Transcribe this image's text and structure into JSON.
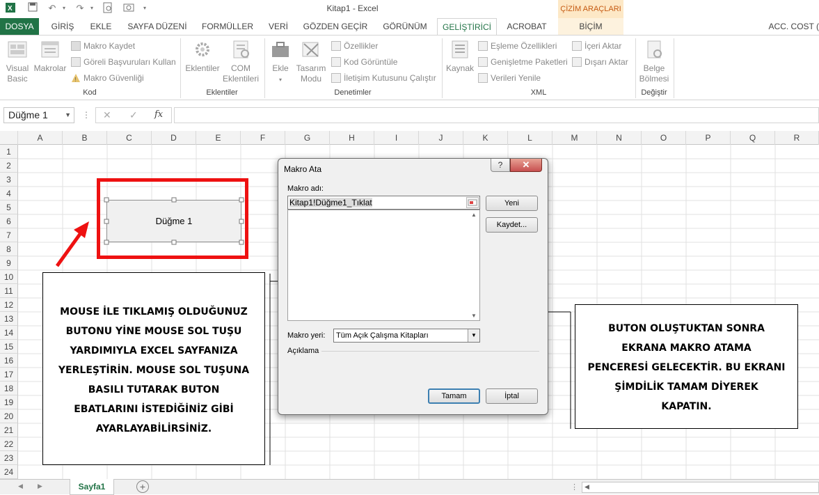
{
  "window": {
    "title": "Kitap1 - Excel"
  },
  "ribbon": {
    "contextual_header": "ÇİZİM ARAÇLARI",
    "tabs": [
      {
        "label": "DOSYA",
        "x": 0
      },
      {
        "label": "GİRİŞ"
      },
      {
        "label": "EKLE"
      },
      {
        "label": "SAYFA DÜZENİ"
      },
      {
        "label": "FORMÜLLER"
      },
      {
        "label": "VERİ"
      },
      {
        "label": "GÖZDEN GEÇİR"
      },
      {
        "label": "GÖRÜNÜM"
      },
      {
        "label": "GELİŞTİRİCİ"
      },
      {
        "label": "ACROBAT"
      },
      {
        "label": "BİÇİM"
      }
    ],
    "account": "ACC. COST (",
    "groups": {
      "kod": {
        "label": "Kod",
        "visual_basic": "Visual Basic",
        "visual_basic_l1": "Visual",
        "visual_basic_l2": "Basic",
        "makrolar": "Makrolar",
        "makro_kaydet": "Makro Kaydet",
        "goreli": "Göreli Başvuruları Kullan",
        "guvenlik": "Makro Güvenliği"
      },
      "eklentiler": {
        "label": "Eklentiler",
        "eklentiler": "Eklentiler",
        "com_l1": "COM",
        "com_l2": "Eklentileri"
      },
      "denetimler": {
        "label": "Denetimler",
        "ekle": "Ekle",
        "tasarim_l1": "Tasarım",
        "tasarim_l2": "Modu",
        "ozellikler": "Özellikler",
        "kod": "Kod Görüntüle",
        "iletisim": "İletişim Kutusunu Çalıştır"
      },
      "xml": {
        "label": "XML",
        "kaynak": "Kaynak",
        "esleme": "Eşleme Özellikleri",
        "genisletme": "Genişletme Paketleri",
        "yenile": "Verileri Yenile",
        "iceri": "İçeri Aktar",
        "disari": "Dışarı Aktar"
      },
      "degistir": {
        "label": "Değiştir",
        "belge_l1": "Belge",
        "belge_l2": "Bölmesi"
      }
    }
  },
  "formula_bar": {
    "name_box": "Düğme 1",
    "fx": "fx",
    "cancel": "✕",
    "enter": "✓",
    "formula": ""
  },
  "grid": {
    "columns": [
      "A",
      "B",
      "C",
      "D",
      "E",
      "F",
      "G",
      "H",
      "I",
      "J",
      "K",
      "L",
      "M",
      "N",
      "O",
      "P",
      "Q",
      "R"
    ],
    "rows": [
      "1",
      "2",
      "3",
      "4",
      "5",
      "6",
      "7",
      "8",
      "9",
      "10",
      "11",
      "12",
      "13",
      "14",
      "15",
      "16",
      "17",
      "18",
      "19",
      "20",
      "21",
      "22",
      "23",
      "24"
    ]
  },
  "button_shape": {
    "label": "Düğme 1"
  },
  "sheets": {
    "active": "Sayfa1"
  },
  "dialog": {
    "title": "Makro Ata",
    "help": "?",
    "close": "✕",
    "macro_name_label": "Makro adı:",
    "macro_name_value": "Kitap1!Düğme1_Tıklat",
    "new_button": "Yeni",
    "record_button": "Kaydet...",
    "location_label": "Makro yeri:",
    "location_value": "Tüm Açık Çalışma Kitapları",
    "description_label": "Açıklama",
    "ok_button": "Tamam",
    "cancel_button": "İptal"
  },
  "notes": {
    "left": [
      "MOUSE İLE TIKLAMIŞ OLDUĞUNUZ",
      "BUTONU YİNE MOUSE SOL TUŞU",
      "YARDIMIYLA EXCEL SAYFANIZA",
      "YERLEŞTİRİN. MOUSE SOL TUŞUNA",
      "BASILI TUTARAK BUTON",
      "EBATLARINI İSTEDİĞİNİZ GİBİ",
      "AYARLAYABİLİRSİNİZ."
    ],
    "right": [
      "BUTON OLUŞTUKTAN SONRA",
      "EKRANA MAKRO ATAMA",
      "PENCERESİ GELECEKTİR. BU EKRANI",
      "ŞİMDİLİK TAMAM DİYEREK",
      "KAPATIN."
    ]
  },
  "colors": {
    "excel_green": "#217346",
    "highlight_red": "#ee1111",
    "contextual_orange": "#c55a11"
  }
}
